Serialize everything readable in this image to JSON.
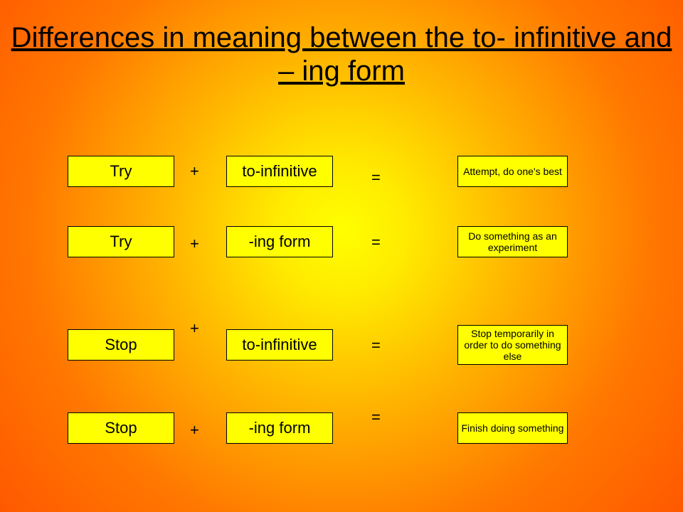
{
  "title": "Differences in meaning between the to- infinitive and – ing form",
  "symbols": {
    "plus": "+",
    "equals": "="
  },
  "rows": [
    {
      "verb": "Try",
      "form": "to-infinitive",
      "meaning": "Attempt, do one's best"
    },
    {
      "verb": "Try",
      "form": "-ing form",
      "meaning": "Do something as an experiment"
    },
    {
      "verb": "Stop",
      "form": "to-infinitive",
      "meaning": "Stop temporarily in order to do something else"
    },
    {
      "verb": "Stop",
      "form": "-ing form",
      "meaning": "Finish doing something"
    }
  ]
}
